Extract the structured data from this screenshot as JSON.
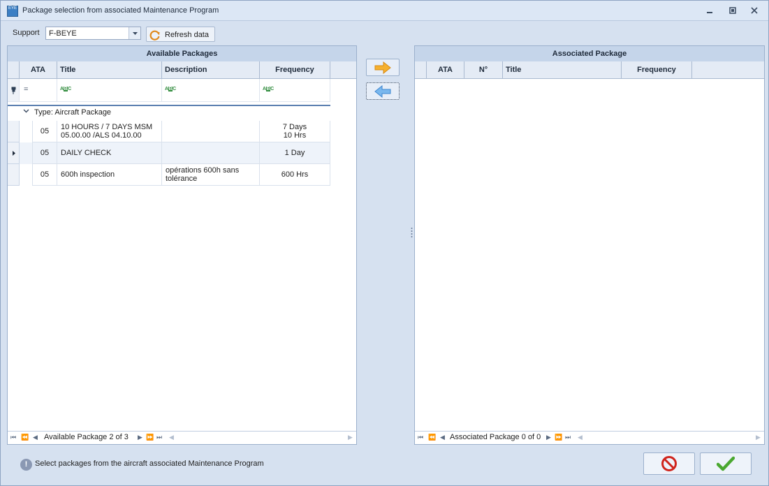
{
  "window": {
    "title": "Package selection from associated Maintenance Program",
    "app_icon_text": "EYE"
  },
  "toolbar": {
    "support_label": "Support",
    "support_value": "F-BEYE",
    "refresh_label": "Refresh data"
  },
  "available": {
    "header": "Available Packages",
    "columns": {
      "ata": "ATA",
      "title": "Title",
      "description": "Description",
      "frequency": "Frequency"
    },
    "filter_ata_symbol": "=",
    "filter_icon": "text-filter-icon",
    "group_label": "Type: Aircraft Package",
    "rows": [
      {
        "ata": "05",
        "title": "10 HOURS / 7 DAYS MSM 05.00.00 /ALS 04.10.00",
        "description": "",
        "frequency": "7 Days\n10 Hrs"
      },
      {
        "ata": "05",
        "title": "DAILY CHECK",
        "description": "",
        "frequency": "1 Day"
      },
      {
        "ata": "05",
        "title": "600h inspection",
        "description": "opérations 600h sans tolérance",
        "frequency": "600 Hrs"
      }
    ],
    "nav_text": "Available Package 2 of 3"
  },
  "associated": {
    "header": "Associated Package",
    "columns": {
      "ata": "ATA",
      "number": "N°",
      "title": "Title",
      "frequency": "Frequency"
    },
    "nav_text": "Associated Package 0 of 0"
  },
  "status": {
    "message": "Select packages from the aircraft associated Maintenance Program"
  },
  "colors": {
    "accent_arrow_right": "#f2a424",
    "accent_arrow_left": "#5aa0e0",
    "cancel": "#d0241c",
    "ok": "#4aa830"
  }
}
